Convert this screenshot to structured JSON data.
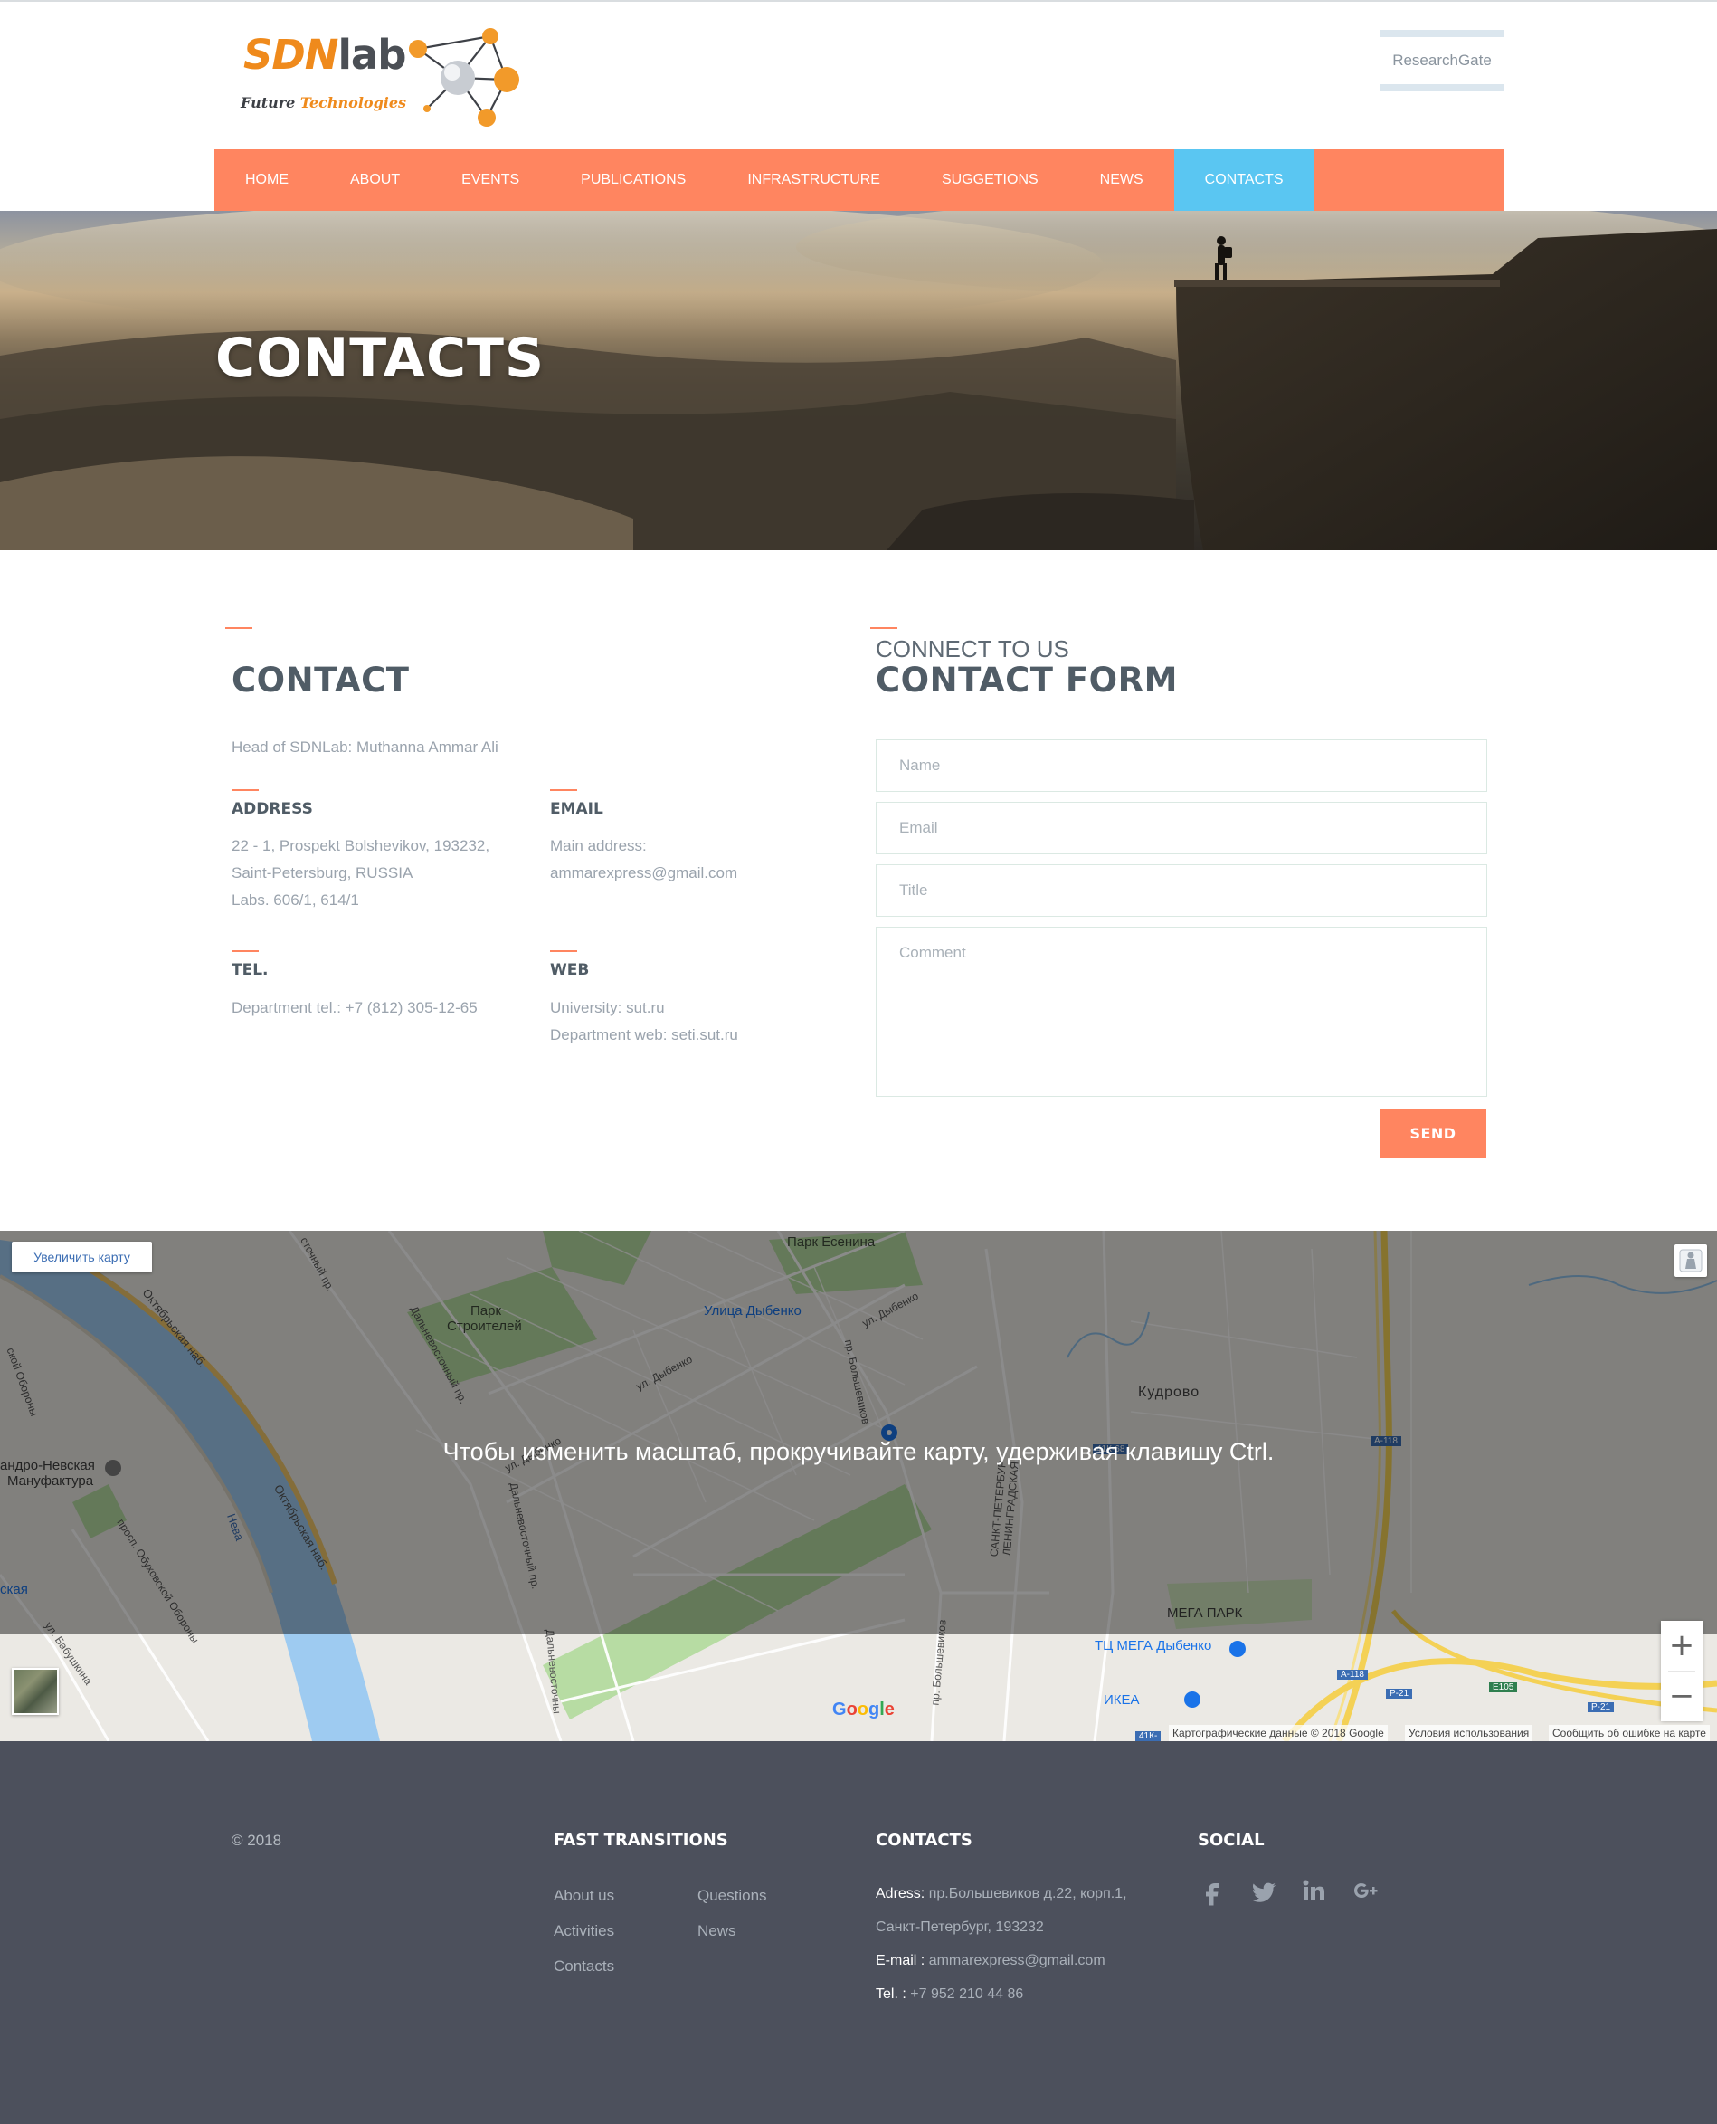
{
  "header": {
    "logo": {
      "brand_part1": "SDN",
      "brand_part2": "lab",
      "tagline_part1": "Future",
      "tagline_part2": "Technologies"
    },
    "researchgate_label": "ResearchGate"
  },
  "nav": {
    "items": [
      "HOME",
      "ABOUT",
      "EVENTS",
      "PUBLICATIONS",
      "INFRASTRUCTURE",
      "SUGGETIONS",
      "NEWS",
      "CONTACTS"
    ],
    "active": "CONTACTS",
    "colors": {
      "bar": "#ff8560",
      "active": "#5ac6f2"
    }
  },
  "hero": {
    "title": "CONTACTS"
  },
  "contact": {
    "title": "CONTACT",
    "head_of_lab": "Head of SDNLab: Muthanna Ammar Ali",
    "address": {
      "heading": "ADDRESS",
      "line1": "22 - 1, Prospekt Bolshevikov, 193232,",
      "line2": "Saint-Petersburg, RUSSIA",
      "line3": "Labs. 606/1, 614/1"
    },
    "email": {
      "heading": "EMAIL",
      "line1": "Main address:",
      "line2": "ammarexpress@gmail.com"
    },
    "tel": {
      "heading": "TEL.",
      "line1": "Department tel.: +7 (812) 305-12-65"
    },
    "web": {
      "heading": "WEB",
      "line1": "University: sut.ru",
      "line2": "Department web: seti.sut.ru"
    }
  },
  "form": {
    "pretitle": "CONNECT TO US",
    "title": "CONTACT FORM",
    "name_placeholder": "Name",
    "email_placeholder": "Email",
    "title_placeholder": "Title",
    "comment_placeholder": "Comment",
    "send_label": "SEND",
    "accent": "#ff8560"
  },
  "map": {
    "enlarge_label": "Увеличить карту",
    "overlay_text": "Чтобы изменить масштаб, прокручивайте карту, удерживая клавишу Ctrl.",
    "labels": {
      "park_esenina": "Парк Есенина",
      "park_stroiteley_1": "Парк",
      "park_stroiteley_2": "Строителей",
      "ulitsa_dybenko_station": "Улица Дыбенко",
      "ul_dybenko_1": "ул. Дыбенко",
      "ul_dybenko_2": "ул. Дыбенко",
      "ul_dybenko_3": "ул. Дыбенко",
      "kudrovo": "Кудрово",
      "oktyabrskaya_1": "Октябрьская наб.",
      "oktyabrskaya_2": "Октябрьская наб.",
      "neva": "Нева",
      "nevsky_manufaktura_1": "андро-Невская",
      "nevsky_manufaktura_2": "Мануфактура",
      "prosp_obukhovskoy": "просп. Обуховской Обороны",
      "oborony": "ской Обороны",
      "station_left": "ская",
      "ul_shkina": "ул. Бабушкина",
      "dalnevostochny_1": "Дальневосточный пр.",
      "dalnevostochny_2": "Дальневосточный пр.",
      "dalnevostochny_3": "Дальневосточны",
      "sochny_pr": "сточный пр.",
      "pr_bolshevikov_1": "пр. Большевиков",
      "pr_bolshevikov_2": "пр. Большевиков",
      "spb_leningrad_1": "САНКТ-ПЕТЕРБУР",
      "spb_leningrad_2": "ЛЕНИНГРАДСКАЯ",
      "mega_park": "МЕГА ПАРК",
      "tc_mega": "ТЦ МЕГА Дыбенко",
      "ikea": "ИКЕА",
      "shield_41k68": "41К-68",
      "shield_a118_1": "А-118",
      "shield_a118_2": "А-118",
      "shield_r21_1": "Р-21",
      "shield_r21_2": "Р-21",
      "shield_e105": "Е105",
      "shield_41k_bottom": "41К-"
    },
    "google_logo": [
      "G",
      "o",
      "o",
      "g",
      "l",
      "e"
    ],
    "footer_data": "Картографические данные © 2018 Google",
    "footer_terms": "Условия использования",
    "footer_report": "Сообщить об ошибке на карте"
  },
  "footer": {
    "copyright": "© 2018",
    "fast_transitions": {
      "title": "FAST TRANSITIONS",
      "links_col1": [
        "About us",
        "Activities",
        "Contacts"
      ],
      "links_col2": [
        "Questions",
        "News"
      ]
    },
    "contacts": {
      "title": "CONTACTS",
      "address_label": "Adress:",
      "address_line1": "пр.Большевиков д.22, корп.1,",
      "address_line2": "Санкт-Петербург, 193232",
      "email_label": "E-mail :",
      "email_value": "ammarexpress@gmail.com",
      "tel_label": "Tel. :",
      "tel_value": "+7 952 210 44 86"
    },
    "social": {
      "title": "SOCIAL",
      "icons": [
        "facebook-icon",
        "twitter-icon",
        "linkedin-icon",
        "google-plus-icon"
      ]
    }
  }
}
